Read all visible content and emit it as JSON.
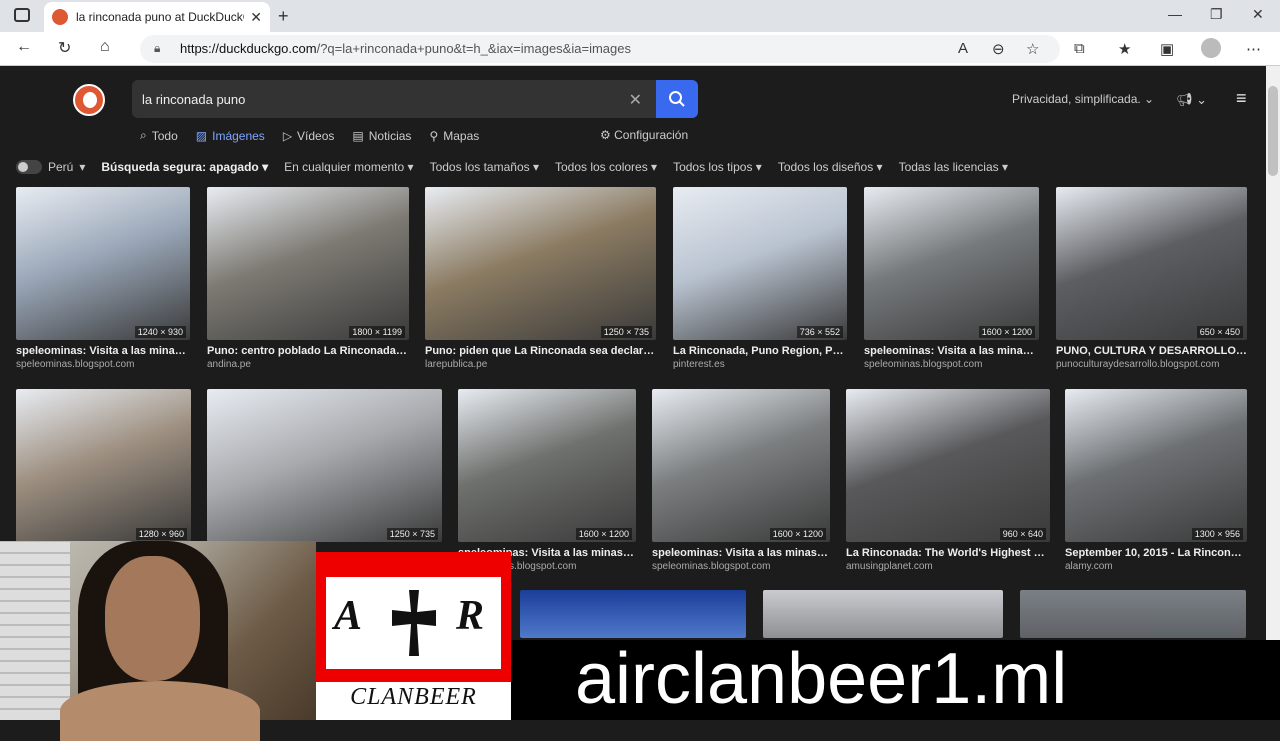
{
  "browser": {
    "tab_title": "la rinconada puno at DuckDuckG",
    "url_host": "https://duckduckgo.com",
    "url_path": "/?q=la+rinconada+puno&t=h_&iax=images&ia=images"
  },
  "search": {
    "query": "la rinconada puno",
    "privacy_label": "Privacidad, simplificada."
  },
  "nav": {
    "all": "Todo",
    "images": "Imágenes",
    "videos": "Vídeos",
    "news": "Noticias",
    "maps": "Mapas",
    "settings": "Configuración"
  },
  "filters": {
    "region": "Perú",
    "safe": "Búsqueda segura: apagado",
    "time": "En cualquier momento",
    "sizes": "Todos los tamaños",
    "colors": "Todos los colores",
    "types": "Todos los tipos",
    "layouts": "Todos los diseños",
    "licenses": "Todas las licencias"
  },
  "results": [
    {
      "title": "speleominas: Visita a las minas d...",
      "source": "speleominas.blogspot.com",
      "dims": "1240 × 930",
      "color": "#9aa7b8"
    },
    {
      "title": "Puno: centro poblado La Rinconada es...",
      "source": "andina.pe",
      "dims": "1800 × 1199",
      "color": "#7d7a73"
    },
    {
      "title": "Puno: piden que La Rinconada sea declarad...",
      "source": "larepublica.pe",
      "dims": "1250 × 735",
      "color": "#8b7b62"
    },
    {
      "title": "La Rinconada, Puno Region, Peru...",
      "source": "pinterest.es",
      "dims": "736 × 552",
      "color": "#b9c3d0"
    },
    {
      "title": "speleominas: Visita a las minas d...",
      "source": "speleominas.blogspot.com",
      "dims": "1600 × 1200",
      "color": "#767a7c"
    },
    {
      "title": "PUNO, CULTURA Y DESARROLLO: L...",
      "source": "punoculturaydesarrollo.blogspot.com",
      "dims": "650 × 450",
      "color": "#5c5e62"
    },
    {
      "title": "",
      "source": "",
      "dims": "1280 × 960",
      "color": "#9d8f80"
    },
    {
      "title": "",
      "source": "",
      "dims": "1250 × 735",
      "color": "#a7a9ad"
    },
    {
      "title": "speleominas: Visita a las minas de...",
      "source": "speleominas.blogspot.com",
      "dims": "1600 × 1200",
      "color": "#6f716e"
    },
    {
      "title": "speleominas: Visita a las minas de...",
      "source": "speleominas.blogspot.com",
      "dims": "1600 × 1200",
      "color": "#7c7f80"
    },
    {
      "title": "La Rinconada: The World's Highest City...",
      "source": "amusingplanet.com",
      "dims": "960 × 640",
      "color": "#59595b"
    },
    {
      "title": "September 10, 2015 - La Rinconad...",
      "source": "alamy.com",
      "dims": "1300 × 956",
      "color": "#6d7073"
    }
  ],
  "overlay": {
    "flag_left": "A",
    "flag_right": "R",
    "flag_bottom": "CLANBEER",
    "banner": "airclanbeer1.ml"
  }
}
